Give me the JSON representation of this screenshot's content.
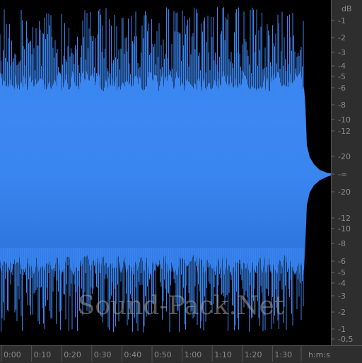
{
  "colors": {
    "waveform": "#3a86f0",
    "waveform_dark": "#2a6fd6",
    "background": "#000000",
    "ruler_bg": "#2e2e2e",
    "ruler_text": "#8a8a8a"
  },
  "db_scale": {
    "unit": "dB",
    "labels": [
      "-1",
      "-2",
      "-3",
      "-4",
      "-5",
      "-6",
      "-8",
      "-10",
      "-12",
      "-20",
      "-∞",
      "-20",
      "-12",
      "-10",
      "-8",
      "-6",
      "-5",
      "-4",
      "-3",
      "-2",
      "-1",
      "-0,5"
    ]
  },
  "time_ruler": {
    "labels": [
      "0:00",
      "0:10",
      "0:20",
      "0:30",
      "0:40",
      "0:50",
      "1:00",
      "1:10",
      "1:20",
      "1:30"
    ],
    "format_label": "h:m:s"
  },
  "watermark": "Sound-Pack.Net"
}
